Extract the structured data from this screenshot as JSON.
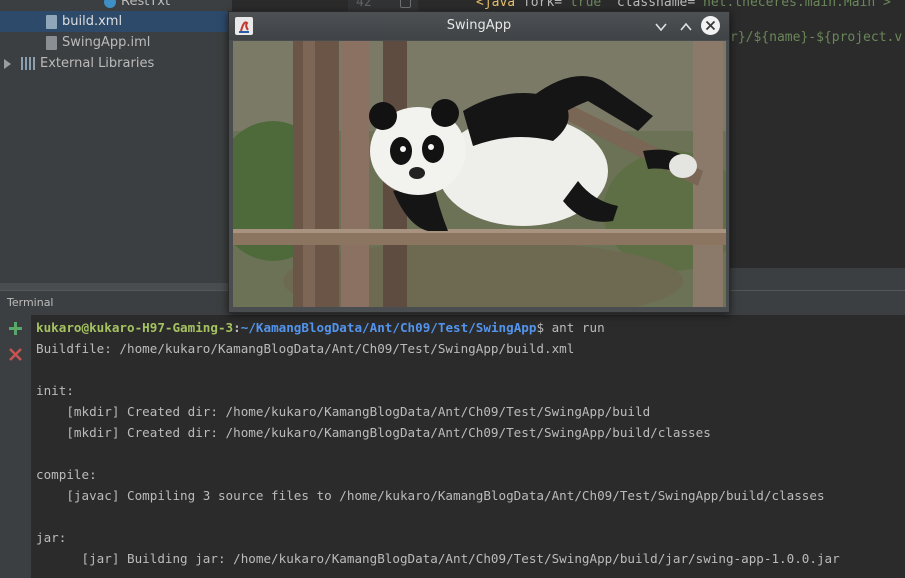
{
  "project_tree": {
    "items": [
      {
        "label": "RestTxt",
        "icon": "class-icon"
      },
      {
        "label": "build.xml",
        "icon": "ant-build-file-icon",
        "selected": true
      },
      {
        "label": "SwingApp.iml",
        "icon": "module-file-icon"
      },
      {
        "label": "External Libraries",
        "icon": "libraries-icon"
      }
    ]
  },
  "editor": {
    "line_number": "42",
    "line42_tag": "<java",
    "line42_attr1": " fork=",
    "line42_val1": "\"true\"",
    "line42_attr2": " classname=",
    "line42_val2": "\"net.theceres.main.Main\">",
    "line43_text": "r}/${name}-${project.v"
  },
  "swing_window": {
    "title": "SwingApp",
    "image_alt": "Panda climbing on a wooden branch"
  },
  "terminal": {
    "title": "Terminal",
    "prompt_user": "kukaro@kukaro-H97-Gaming-3",
    "prompt_sep": ":",
    "prompt_path": "~/KamangBlogData/Ant/Ch09/Test/SwingApp",
    "prompt_cmd": "$ ant run",
    "lines": [
      "Buildfile: /home/kukaro/KamangBlogData/Ant/Ch09/Test/SwingApp/build.xml",
      "",
      "init:",
      "    [mkdir] Created dir: /home/kukaro/KamangBlogData/Ant/Ch09/Test/SwingApp/build",
      "    [mkdir] Created dir: /home/kukaro/KamangBlogData/Ant/Ch09/Test/SwingApp/build/classes",
      "",
      "compile:",
      "    [javac] Compiling 3 source files to /home/kukaro/KamangBlogData/Ant/Ch09/Test/SwingApp/build/classes",
      "",
      "jar:",
      "      [jar] Building jar: /home/kukaro/KamangBlogData/Ant/Ch09/Test/SwingApp/build/jar/swing-app-1.0.0.jar"
    ]
  },
  "colors": {
    "prompt_user": "#a5c261",
    "prompt_path": "#5394ec",
    "add_icon": "#59a869",
    "close_icon": "#c75450",
    "xml_tag": "#e8bf6a",
    "xml_value": "#6a8759"
  }
}
